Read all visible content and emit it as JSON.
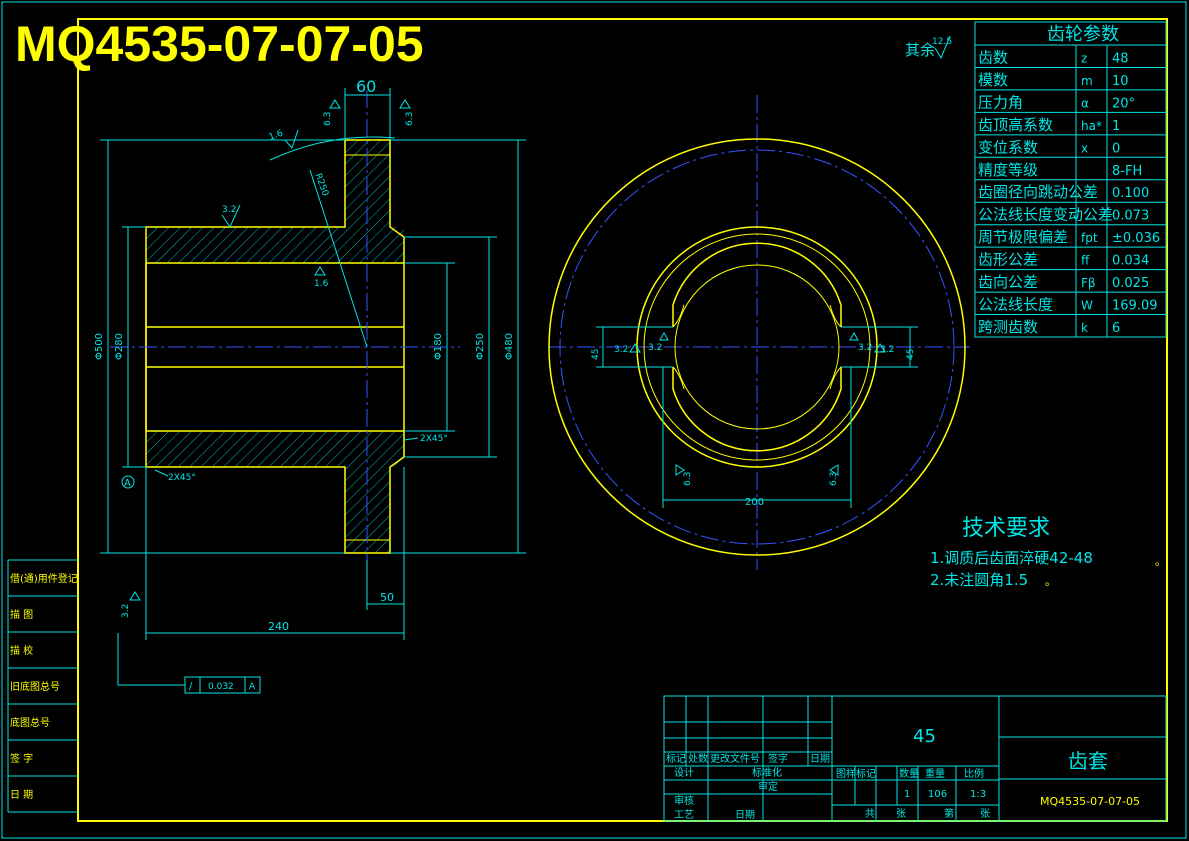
{
  "drawing_number": "MQ4535-07-07-05",
  "roughness_note": {
    "label": "其余",
    "value": "12.5"
  },
  "gear_params": {
    "title": "齿轮参数",
    "rows": [
      {
        "name": "齿数",
        "symbol": "z",
        "value": "48"
      },
      {
        "name": "模数",
        "symbol": "m",
        "value": "10"
      },
      {
        "name": "压力角",
        "symbol": "α",
        "value": "20°"
      },
      {
        "name": "齿顶高系数",
        "symbol": "ha*",
        "value": "1"
      },
      {
        "name": "变位系数",
        "symbol": "x",
        "value": "0"
      },
      {
        "name": "精度等级",
        "symbol": "",
        "value": "8-FH"
      },
      {
        "name": "齿圈径向跳动公差",
        "symbol": "",
        "value": "0.100"
      },
      {
        "name": "公法线长度变动公差",
        "symbol": "",
        "value": "0.073"
      },
      {
        "name": "周节极限偏差",
        "symbol": "fpt",
        "value": "±0.036"
      },
      {
        "name": "齿形公差",
        "symbol": "ff",
        "value": "0.034"
      },
      {
        "name": "齿向公差",
        "symbol": "Fβ",
        "value": "0.025"
      },
      {
        "name": "公法线长度",
        "symbol": "W",
        "value": "169.09"
      },
      {
        "name": "跨测齿数",
        "symbol": "k",
        "value": "6"
      }
    ]
  },
  "tech_req": {
    "title": "技术要求",
    "items": [
      "1.调质后齿面淬硬42-48",
      "2.未注圆角1.5"
    ],
    "item_suffix": "。"
  },
  "dims": {
    "d60": "60",
    "r63a": "6.3",
    "r63b": "6.3",
    "r16a": "1.6",
    "r16b": "1.6",
    "r32a": "3.2",
    "r32b": "3.2",
    "r32c": "3.2",
    "r32d": "3.2",
    "r32e": "3.2",
    "r32f": "3.2",
    "r63c": "6.3",
    "r63d": "6.3",
    "rad250": "R250",
    "d500": "Φ500",
    "d280": "Φ280",
    "d180": "Φ180",
    "d250": "Φ250",
    "d480": "Φ480",
    "ch45a": "2X45°",
    "ch45b": "2X45°",
    "d240": "240",
    "d50": "50",
    "key45a": "45",
    "key45b": "45",
    "d200": "200",
    "datum": "A",
    "runout_symbol": "/",
    "runout_value": "0.032",
    "runout_datum": "A"
  },
  "left_strip": [
    "借(通)用件登记",
    "描  图",
    "描  校",
    "旧底图总号",
    "底图总号",
    "签  字",
    "日  期"
  ],
  "title_block": {
    "material": "45",
    "part_name": "齿套",
    "drawing_no": "MQ4535-07-07-05",
    "rev_headers": [
      "标记",
      "处数",
      "更改文件号",
      "签字",
      "日期"
    ],
    "sign_rows": [
      "设计",
      "标准化",
      "审定",
      "审核",
      "工艺",
      "日期"
    ],
    "stage_headers": [
      "图样标记",
      "数量",
      "重量",
      "比例"
    ],
    "stage_values": [
      "1",
      "106",
      "1:3"
    ],
    "sheet_labels": [
      "共",
      "张",
      "第",
      "张"
    ]
  }
}
